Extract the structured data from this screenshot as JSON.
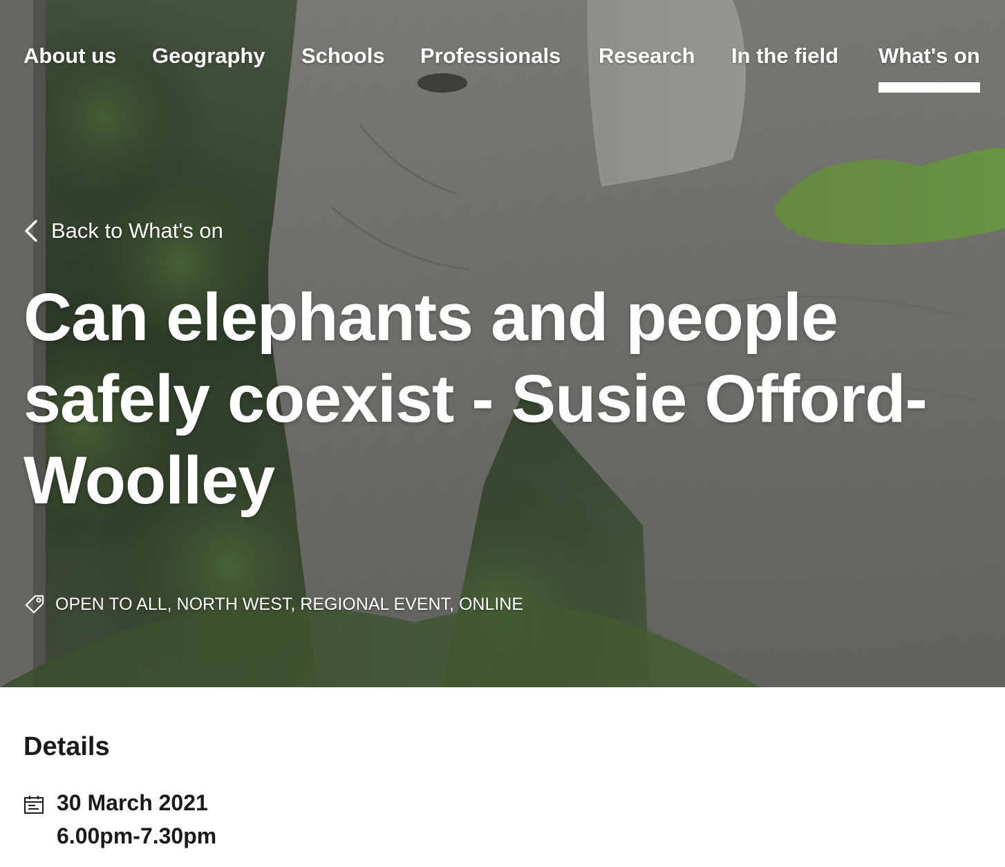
{
  "nav": {
    "items": [
      {
        "label": "About us"
      },
      {
        "label": "Geography"
      },
      {
        "label": "Schools"
      },
      {
        "label": "Professionals"
      },
      {
        "label": "Research"
      },
      {
        "label": "In the field"
      },
      {
        "label": "What's on",
        "active": true
      }
    ]
  },
  "hero": {
    "image_subject": "elephant in forest",
    "back_link": "Back to What's on",
    "title": "Can elephants and people safely coexist - Susie Offord-Woolley",
    "tags": "OPEN TO ALL, NORTH WEST, REGIONAL EVENT, ONLINE"
  },
  "details": {
    "heading": "Details",
    "date": "30 March 2021",
    "time": "6.00pm-7.30pm"
  },
  "icons": {
    "back": "chevron-left-icon",
    "tag": "tag-icon",
    "date": "calendar-icon"
  },
  "colors": {
    "text_on_image": "#ffffff",
    "body_text": "#1a1a1a",
    "background": "#ffffff"
  }
}
